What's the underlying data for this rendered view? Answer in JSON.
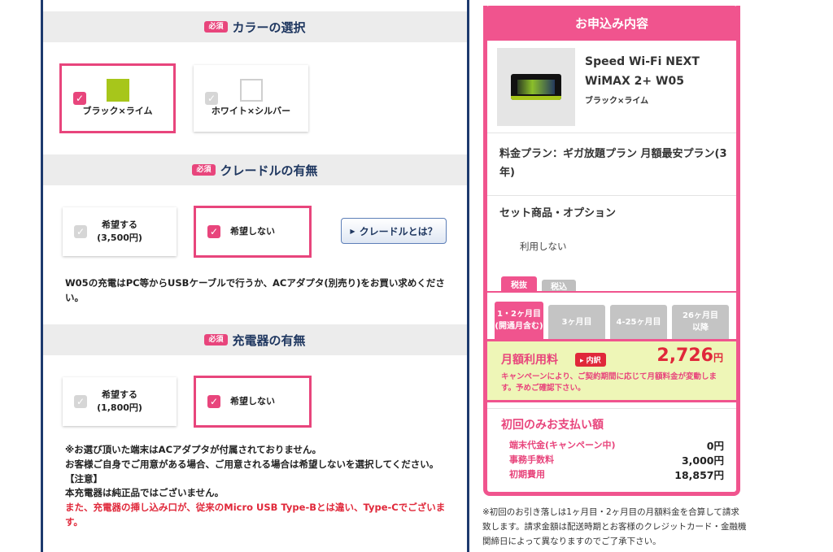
{
  "required_badge": "必須",
  "color_section": {
    "title": "カラーの選択",
    "options": [
      {
        "label": "ブラック×ライム",
        "swatch": "#a7c61b",
        "selected": true
      },
      {
        "label": "ホワイト×シルバー",
        "swatch": "#ffffff",
        "selected": false
      }
    ]
  },
  "cradle_section": {
    "title": "クレードルの有無",
    "options": [
      {
        "line1": "希望する",
        "line2": "(3,500円)",
        "selected": false
      },
      {
        "label": "希望しない",
        "selected": true
      }
    ],
    "info_button": "クレードルとは？",
    "note": "W05の充電はPC等からUSBケーブルで行うか、ACアダプタ(別売り)をお買い求めください。"
  },
  "charger_section": {
    "title": "充電器の有無",
    "options": [
      {
        "line1": "希望する",
        "line2": "(1,800円)",
        "selected": false
      },
      {
        "label": "希望しない",
        "selected": true
      }
    ],
    "note1": "※お選び頂いた端末はACアダプタが付属されておりません。",
    "note2": "お客様ご自身でご用意がある場合、ご用意される場合は希望しないを選択してください。",
    "caution_title": "【注意】",
    "caution1": "本充電器は純正品ではございません。",
    "caution2": "また、充電器の挿し込み口が、従来のMicro USB Type-Bとは違い、Type-Cでございます。"
  },
  "summary": {
    "title": "お申込み内容",
    "product_name_1": "Speed Wi-Fi NEXT",
    "product_name_2": "WiMAX 2+ W05",
    "product_color": "ブラック×ライム",
    "plan": "料金プラン：ギガ放題プラン 月額最安プラン(3年)",
    "set_title": "セット商品・オプション",
    "set_value": "利用しない",
    "tax_tabs": [
      "税抜",
      "税込"
    ],
    "month_tabs": [
      {
        "line1": "1・2ヶ月目",
        "line2": "(開通月含む)"
      },
      {
        "line1": "3ヶ月目",
        "line2": ""
      },
      {
        "line1": "4-25ヶ月目",
        "line2": ""
      },
      {
        "line1": "26ヶ月目",
        "line2": "以降"
      }
    ],
    "monthly_label": "月額利用料",
    "breakdown_badge": "内訳",
    "monthly_amount": "2,726",
    "yen": "円",
    "monthly_note": "キャンペーンにより、ご契約期間に応じて月額料金が変動します。予めご確認下さい。",
    "initial_title": "初回のみお支払い額",
    "initial_rows": [
      {
        "label": "端末代金(キャンペーン中)",
        "value": "0円"
      },
      {
        "label": "事務手数料",
        "value": "3,000円"
      },
      {
        "label": "初期費用",
        "value": "18,857円"
      }
    ]
  },
  "footnote": "※初回のお引き落しは1ヶ月目・2ヶ月目の月額料金を合算して請求致します。請求金額は配送時期とお客様のクレジットカード・金融機関締日によって異なりますのでご了承下さい。",
  "colors": {
    "accent": "#f0548e",
    "navy": "#1f3760",
    "red": "#e0283a",
    "fee_bg": "#eef6b7"
  }
}
